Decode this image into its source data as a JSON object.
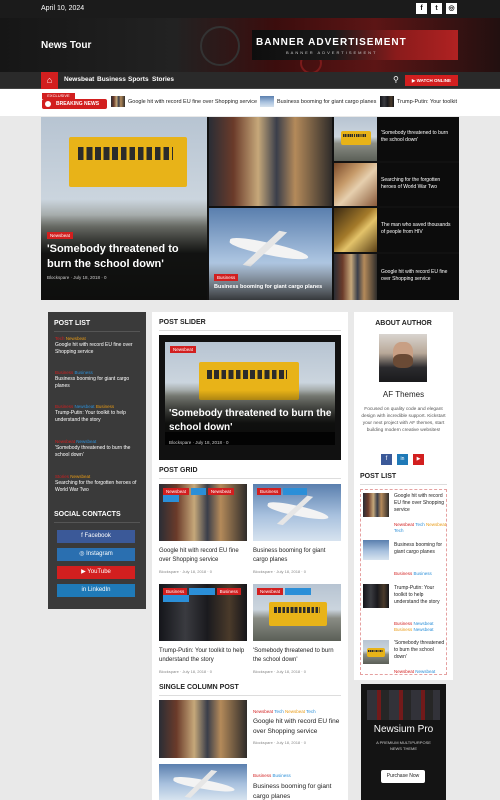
{
  "topbar": {
    "date": "April 10, 2024",
    "social": [
      "f",
      "t",
      "◎"
    ]
  },
  "header": {
    "site_name": "News Tour",
    "banner_title": "BANNER ADVERTISEMENT",
    "banner_sub": "BANNER ADVERTISEMENT"
  },
  "nav": {
    "items": [
      "Newsbeat",
      "Business",
      "Sports",
      "Stories"
    ],
    "watch_label": "WATCH ONLINE"
  },
  "ticker": {
    "exclusive": "EXCLUSIVE",
    "breaking": "BREAKING NEWS",
    "items": [
      "Google hit with record EU fine over Shopping service",
      "Business booming for giant cargo planes",
      "Trump-Putin: Your toolkit"
    ]
  },
  "hero": {
    "main": {
      "category": "Newsbeat",
      "title": "'Somebody threatened to burn the school down'",
      "author": "Blockspare",
      "date": "July 18, 2018",
      "comments": "0"
    },
    "plane": {
      "category": "Business",
      "title": "Business booming for giant cargo planes"
    },
    "side": [
      "'Somebody threatened to burn the school down'",
      "Searching for the forgotten heroes of World War Two",
      "The man who saved thousands of people from HIV",
      "Google hit with record EU fine over Shopping service"
    ]
  },
  "left": {
    "post_list_title": "POST LIST",
    "posts": [
      {
        "tags": [
          "Newsbeat"
        ],
        "title": "Google hit with record EU fine over Shopping service"
      },
      {
        "tags": [
          "Business"
        ],
        "title": "Business booming for giant cargo planes"
      },
      {
        "tags": [
          "Newsbeat",
          "Business"
        ],
        "title": "Trump-Putin: Your toolkit to help understand the story"
      },
      {
        "tags": [
          "Newsbeat"
        ],
        "title": "'Somebody threatened to burn the school down'"
      },
      {
        "tags": [
          "Newsbeat"
        ],
        "title": "Searching for the forgotten heroes of World War Two"
      }
    ],
    "social_title": "SOCIAL CONTACTS",
    "social": [
      "Facebook",
      "Instagram",
      "YouTube",
      "LinkedIn"
    ]
  },
  "center": {
    "slider_title": "POST SLIDER",
    "slider": {
      "category": "Newsbeat",
      "title": "'Somebody threatened to burn the school down'",
      "author": "Blockspare",
      "date": "July 18, 2018",
      "comments": "0"
    },
    "grid_title": "POST GRID",
    "grid": [
      {
        "tags": [
          "Newsbeat",
          "Tech",
          "Newsbeat",
          "Tech"
        ],
        "title": "Google hit with record EU fine over Shopping service",
        "author": "Blockspare",
        "date": "July 18, 2018",
        "comments": "0"
      },
      {
        "tags": [
          "Business",
          "Business"
        ],
        "title": "Business booming for giant cargo planes",
        "author": "Blockspare",
        "date": "July 18, 2018",
        "comments": "0"
      },
      {
        "tags": [
          "Business",
          "Newsbeat",
          "Business",
          "Newsbeat"
        ],
        "title": "Trump-Putin: Your toolkit to help understand the story",
        "author": "Blockspare",
        "date": "July 18, 2018",
        "comments": "0"
      },
      {
        "tags": [
          "Newsbeat",
          "Newsbeat"
        ],
        "title": "'Somebody threatened to burn the school down'",
        "author": "Blockspare",
        "date": "July 18, 2018",
        "comments": "0"
      }
    ],
    "single_title": "SINGLE COLUMN POST",
    "single": [
      {
        "tags": [
          "Newsbeat",
          "Tech",
          "Newsbeat",
          "Tech"
        ],
        "title": "Google hit with record EU fine over Shopping service",
        "author": "Blockspare",
        "date": "July 18, 2018",
        "comments": "0"
      },
      {
        "tags": [
          "Business",
          "Business"
        ],
        "title": "Business booming for giant cargo planes"
      }
    ]
  },
  "right": {
    "about_title": "ABOUT AUTHOR",
    "author_name": "AF Themes",
    "author_bio": "Focused on quality code and elegant design with incredible support. Kickstart your next project with AF themes, start building modern creative websites!",
    "post_list_title": "POST LIST",
    "posts": [
      {
        "title": "Google hit with record EU fine over Shopping service",
        "tags": [
          "Newsbeat",
          "Tech",
          "Newsbeat",
          "Tech"
        ]
      },
      {
        "title": "Business booming for giant cargo planes",
        "tags": [
          "Business",
          "Business"
        ]
      },
      {
        "title": "Trump-Putin: Your toolkit to help understand the story",
        "tags": [
          "Business",
          "Newsbeat",
          "Business",
          "Newsbeat"
        ]
      },
      {
        "title": "'Somebody threatened to burn the school down'",
        "tags": [
          "Newsbeat",
          "Newsbeat"
        ]
      }
    ],
    "promo": {
      "name": "Newsium Pro",
      "tagline": "A PREMIUM MULTIPURPOSE NEWS THEME",
      "button": "Purchase Now"
    }
  },
  "colors": {
    "accent": "#d21f1f",
    "blue": "#2b8fd8",
    "facebook": "#3b5998",
    "instagram": "#2a6fb0",
    "youtube": "#d21f1f",
    "linkedin": "#1f7ab8"
  }
}
